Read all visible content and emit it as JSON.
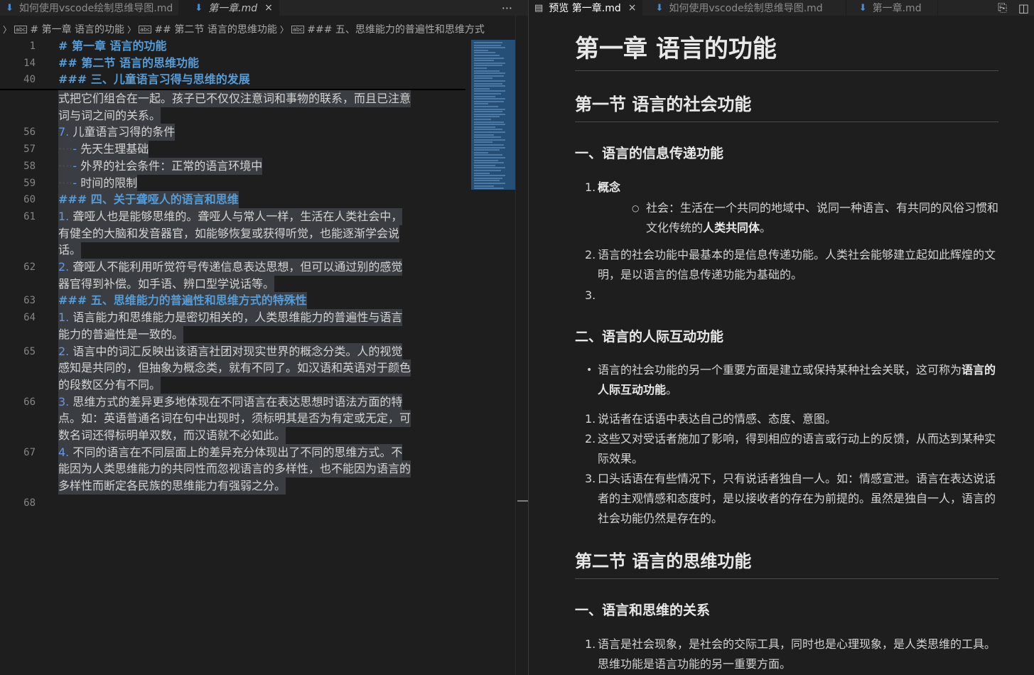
{
  "left_tabs": [
    {
      "label": "如何使用vscode绘制思维导图.md",
      "icon": "markdown-file-icon"
    },
    {
      "label": "第一章.md",
      "icon": "markdown-file-icon",
      "close": "×"
    }
  ],
  "left_tab_actions": {
    "more": "···"
  },
  "breadcrumb": {
    "items": [
      "# 第一章 语言的功能",
      "## 第二节 语言的思维功能",
      "### 五、思维能力的普遍性和思维方式"
    ],
    "sym": "abc"
  },
  "editor": {
    "sticky": [
      {
        "ln": "1",
        "text": "# 第一章  语言的功能"
      },
      {
        "ln": "14",
        "text": "## 第二节  语言的思维功能"
      },
      {
        "ln": "40",
        "text": "### 三、儿童语言习得与思维的发展"
      }
    ],
    "lines": [
      {
        "ln": "",
        "text": "式把它们组合在一起。孩子已不仅仅注意词和事物的联系，而且已注意"
      },
      {
        "ln": "",
        "text": "词与词之间的关系。"
      },
      {
        "ln": "56",
        "num": "7.",
        "text": " 儿童语言习得的条件"
      },
      {
        "ln": "57",
        "ws": "····",
        "dash": "-",
        "text": " 先天生理基础"
      },
      {
        "ln": "58",
        "ws": "····",
        "dash": "-",
        "text": " 外界的社会条件：正常的语言环境中"
      },
      {
        "ln": "59",
        "ws": "····",
        "dash": "-",
        "text": " 时间的限制"
      },
      {
        "ln": "60",
        "head": "### 四、关于聋哑人的语言和思维"
      },
      {
        "ln": "61",
        "num": "1.",
        "text": " 聋哑人也是能够思维的。聋哑人与常人一样，生活在人类社会中，"
      },
      {
        "ln": "",
        "text": "有健全的大脑和发音器官，如能够恢复或获得听觉，也能逐渐学会说"
      },
      {
        "ln": "",
        "text": "话。"
      },
      {
        "ln": "62",
        "num": "2.",
        "text": " 聋哑人不能利用听觉符号传递信息表达思想，但可以通过别的感觉"
      },
      {
        "ln": "",
        "text": "器官得到补偿。如手语、辨口型学说话等。"
      },
      {
        "ln": "63",
        "head": "### 五、思维能力的普遍性和思维方式的特殊性"
      },
      {
        "ln": "64",
        "num": "1.",
        "text": " 语言能力和思维能力是密切相关的，人类思维能力的普遍性与语言"
      },
      {
        "ln": "",
        "text": "能力的普遍性是一致的。"
      },
      {
        "ln": "65",
        "num": "2.",
        "text": " 语言中的词汇反映出该语言社团对现实世界的概念分类。人的视觉"
      },
      {
        "ln": "",
        "text": "感知是共同的，但抽象为概念类，就有不同了。如汉语和英语对于颜色"
      },
      {
        "ln": "",
        "text": "的段数区分有不同。"
      },
      {
        "ln": "66",
        "num": "3.",
        "text": " 思维方式的差异更多地体现在不同语言在表达思想时语法方面的特"
      },
      {
        "ln": "",
        "text": "点。如：英语普通名词在句中出现时，须标明其是否为有定或无定，可"
      },
      {
        "ln": "",
        "text": "数名词还得标明单双数，而汉语就不必如此。"
      },
      {
        "ln": "67",
        "num": "4.",
        "text": " 不同的语言在不同层面上的差异充分体现出了不同的思维方式。不"
      },
      {
        "ln": "",
        "text": "能因为人类思维能力的共同性而忽视语言的多样性，也不能因为语言的"
      },
      {
        "ln": "",
        "text": "多样性而断定各民族的思维能力有强弱之分。"
      },
      {
        "ln": "68",
        "text": ""
      }
    ]
  },
  "right_tabs": [
    {
      "label": "预览 第一章.md",
      "icon": "preview-icon",
      "close": "×"
    },
    {
      "label": "如何使用vscode绘制思维导图.md",
      "icon": "markdown-file-icon"
    },
    {
      "label": "第一章.md",
      "icon": "markdown-file-icon"
    }
  ],
  "preview": {
    "h1": "第一章 语言的功能",
    "sec1": "第一节 语言的社会功能",
    "sub1": "一、语言的信息传递功能",
    "s1_item1_marker": "1.",
    "s1_item1": "概念",
    "s1_sub_marker": "○",
    "s1_sub_text": "社会：生活在一个共同的地域中、说同一种语言、有共同的风俗习惯和文化传统的",
    "s1_sub_bold": "人类共同体",
    "s1_sub_end": "。",
    "s1_item2_marker": "2.",
    "s1_item2": "语言的社会功能中最基本的是信息传递功能。人类社会能够建立起如此辉煌的文明，是以语言的信息传递功能为基础的。",
    "s1_item3_marker": "3.",
    "sub2": "二、语言的人际互动功能",
    "s2_bullet_marker": "•",
    "s2_bullet_text": "语言的社会功能的另一个重要方面是建立或保持某种社会关联，这可称为",
    "s2_bullet_bold": "语言的人际互动功能",
    "s2_bullet_end": "。",
    "s2_items": [
      {
        "marker": "1.",
        "text": "说话者在话语中表达自己的情感、态度、意图。"
      },
      {
        "marker": "2.",
        "text": "这些又对受话者施加了影响，得到相应的语言或行动上的反馈，从而达到某种实际效果。"
      },
      {
        "marker": "3.",
        "text": "口头话语在有些情况下，只有说话者独自一人。如：情感宣泄。语言在表达说话者的主观情感和态度时，是以接收者的存在为前提的。虽然是独自一人，语言的社会功能仍然是存在的。"
      }
    ],
    "sec2": "第二节 语言的思维功能",
    "sub3": "一、语言和思维的关系",
    "s3_item1_marker": "1.",
    "s3_item1": "语言是社会现象，是社会的交际工具，同时也是心理现象，是人类思维的工具。思维功能是语言功能的另一重要方面。"
  }
}
